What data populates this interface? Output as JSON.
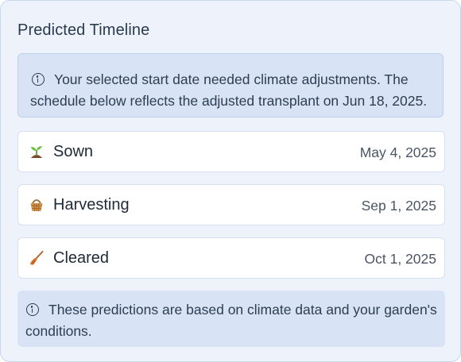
{
  "panel": {
    "title": "Predicted Timeline"
  },
  "notice": {
    "icon": "info-icon",
    "text": "Your selected start date needed climate adjustments. The schedule below reflects the adjusted transplant on Jun 18, 2025."
  },
  "timeline": [
    {
      "icon": "seedling-icon",
      "label": "Sown",
      "date": "May 4, 2025"
    },
    {
      "icon": "basket-icon",
      "label": "Harvesting",
      "date": "Sep 1, 2025"
    },
    {
      "icon": "broom-icon",
      "label": "Cleared",
      "date": "Oct 1, 2025"
    }
  ],
  "footer": {
    "icon": "info-icon",
    "text": "These predictions are based on climate data and your garden's conditions."
  },
  "colors": {
    "panel_bg": "#edf2fb",
    "notice_bg": "#d8e4f5",
    "row_bg": "#ffffff",
    "text": "#2d3d53"
  }
}
